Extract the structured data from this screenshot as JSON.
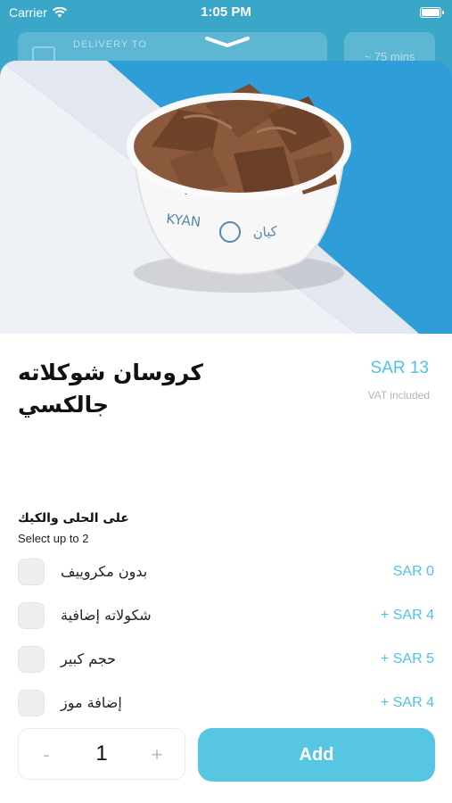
{
  "status_bar": {
    "carrier": "Carrier",
    "time": "1:05 PM"
  },
  "background": {
    "delivery_label": "DELIVERY TO",
    "eta": "~ 75 mins"
  },
  "product": {
    "title": "كروسان شوكلاته جالكسي",
    "price": "SAR 13",
    "vat_note": "VAT included",
    "cup_brand_en": "KYAN",
    "cup_brand_ar": "كيان"
  },
  "options_group": {
    "title": "على الحلى والكيك",
    "subtitle": "Select up to 2",
    "options": [
      {
        "label": "بدون مكروييف",
        "price": "SAR 0"
      },
      {
        "label": "شكولاته إضافية",
        "price": "+  SAR 4"
      },
      {
        "label": "حجم كبير",
        "price": "+  SAR 5"
      },
      {
        "label": "إضافة موز",
        "price": "+  SAR 4"
      }
    ]
  },
  "cart": {
    "minus": "-",
    "quantity": "1",
    "plus": "+",
    "add_label": "Add"
  },
  "colors": {
    "accent": "#4fc3e4",
    "add_button": "#57c6e3",
    "hero_bg": "#2f9dd8"
  }
}
